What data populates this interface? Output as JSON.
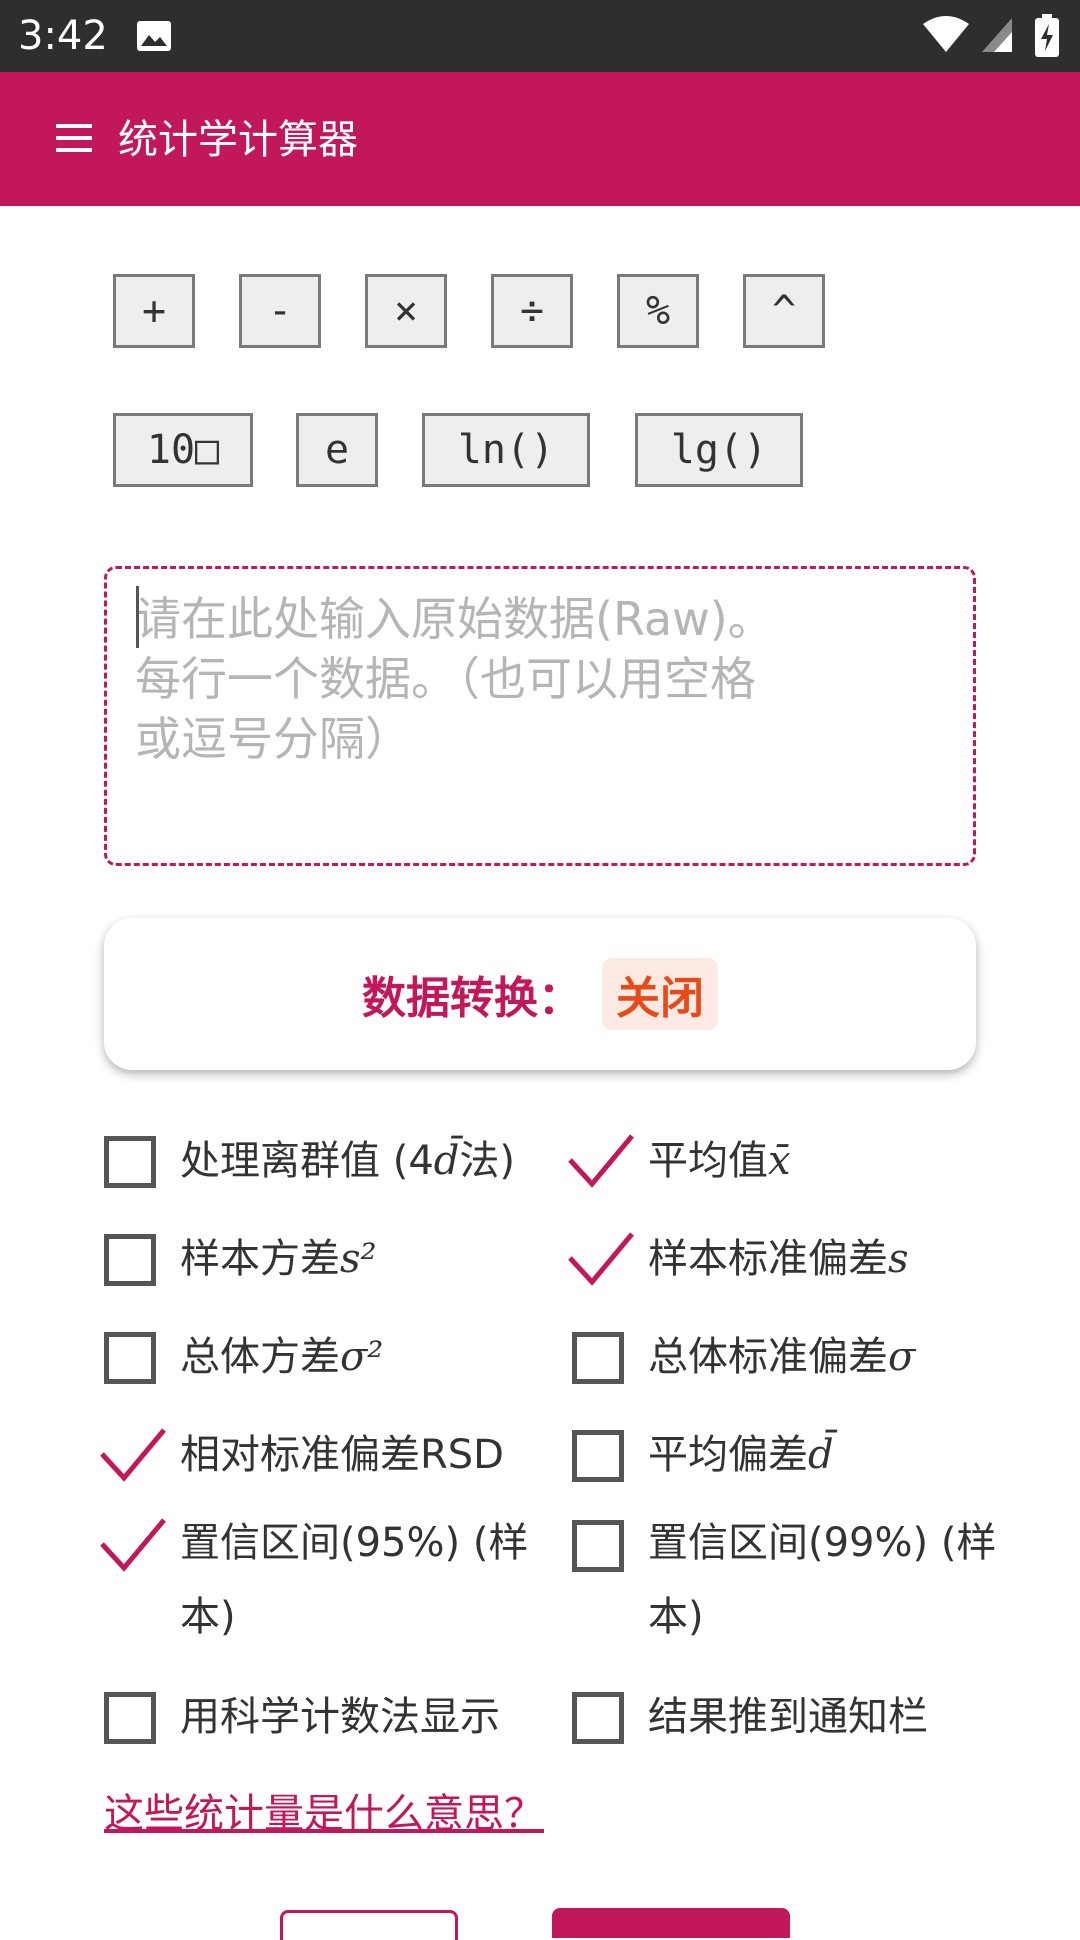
{
  "status_bar": {
    "time": "3:42",
    "icons": [
      "image-icon",
      "wifi-icon",
      "signal-icon",
      "battery-icon"
    ]
  },
  "app_bar": {
    "menu_icon": "menu-icon",
    "title": "统计学计算器"
  },
  "keypad": {
    "row1": [
      "+",
      "-",
      "×",
      "÷",
      "%",
      "^"
    ],
    "row2": [
      "10□",
      "e",
      "ln()",
      "lg()"
    ]
  },
  "raw_input": {
    "value": "",
    "placeholder": "请在此处输入原始数据(Raw)。\n每行一个数据。（也可以用空格\n或逗号分隔）"
  },
  "conversion": {
    "label": "数据转换：",
    "state": "关闭"
  },
  "options": [
    {
      "label": "处理离群值 (4",
      "math": "d̄",
      "suffix": "法)",
      "checked": false
    },
    {
      "label": "平均值",
      "math": "x̄",
      "suffix": "",
      "checked": true
    },
    {
      "label": "样本方差",
      "math": "s²",
      "suffix": "",
      "checked": false
    },
    {
      "label": "样本标准偏差",
      "math": "s",
      "suffix": "",
      "checked": true
    },
    {
      "label": "总体方差",
      "math": "σ²",
      "suffix": "",
      "checked": false
    },
    {
      "label": "总体标准偏差",
      "math": "σ",
      "suffix": "",
      "checked": false
    },
    {
      "label": "相对标准偏差RSD",
      "math": "",
      "suffix": "",
      "checked": true
    },
    {
      "label": "平均偏差",
      "math": "d̄",
      "suffix": "",
      "checked": false
    },
    {
      "label": "置信区间(95%) (样本)",
      "math": "",
      "suffix": "",
      "checked": true
    },
    {
      "label": "置信区间(99%) (样本)",
      "math": "",
      "suffix": "",
      "checked": false
    },
    {
      "label": "用科学计数法显示",
      "math": "",
      "suffix": "",
      "checked": false
    },
    {
      "label": "结果推到通知栏",
      "math": "",
      "suffix": "",
      "checked": false
    }
  ],
  "help_link": "这些统计量是什么意思？",
  "colors": {
    "primary": "#c2185b",
    "status_bar": "#2e2e2e",
    "accent_off": "#e64a19"
  }
}
